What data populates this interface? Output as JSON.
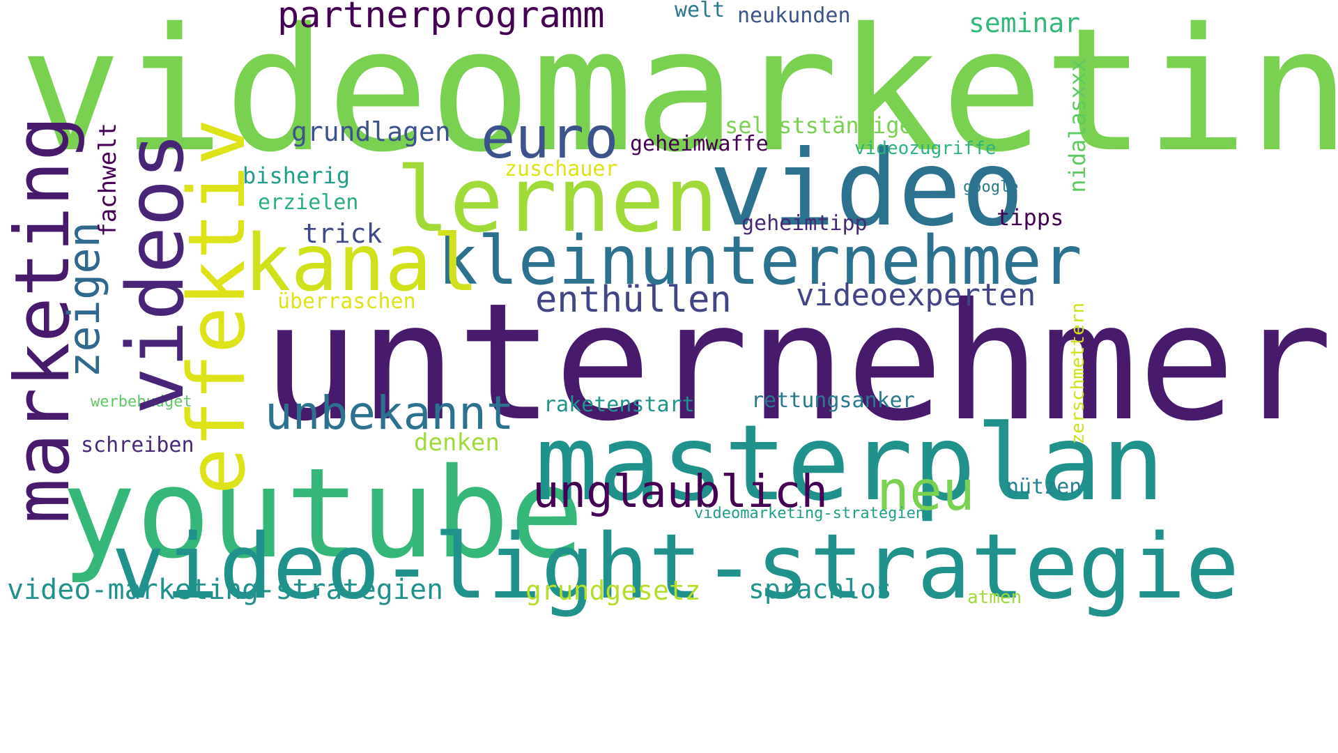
{
  "words": {
    "videomarketing": {
      "text": "videomarketing",
      "color": "#7ad151"
    },
    "unternehmer": {
      "text": "unternehmer",
      "color": "#481a6c"
    },
    "marketing": {
      "text": "marketing",
      "color": "#481a6c"
    },
    "videos": {
      "text": "videos",
      "color": "#482576"
    },
    "effektiv": {
      "text": "effektiv",
      "color": "#dde318"
    },
    "zeigen": {
      "text": "zeigen",
      "color": "#31688e"
    },
    "fachwelt": {
      "text": "fachwelt",
      "color": "#440154"
    },
    "youtube": {
      "text": "youtube",
      "color": "#35b779"
    },
    "masterplan": {
      "text": "masterplan",
      "color": "#21918c"
    },
    "video_light_strategie": {
      "text": "video-light-strategie",
      "color": "#21918c"
    },
    "video": {
      "text": "video",
      "color": "#2c728e"
    },
    "kleinunternehmer": {
      "text": "kleinunternehmer",
      "color": "#2c728e"
    },
    "lernen": {
      "text": "lernen",
      "color": "#a0da39"
    },
    "kanal": {
      "text": "kanal",
      "color": "#d0e11c"
    },
    "euro": {
      "text": "euro",
      "color": "#3b528b"
    },
    "partnerprogramm": {
      "text": "partnerprogramm",
      "color": "#440154"
    },
    "grundlagen": {
      "text": "grundlagen",
      "color": "#3b528b"
    },
    "unbekannt": {
      "text": "unbekannt",
      "color": "#2c728e"
    },
    "unglaublich": {
      "text": "unglaublich",
      "color": "#440154"
    },
    "neu": {
      "text": "neu",
      "color": "#7ad151"
    },
    "enthuellen": {
      "text": "enthüllen",
      "color": "#414487"
    },
    "videoexperten": {
      "text": "videoexperten",
      "color": "#414487"
    },
    "video_marketing_strategien": {
      "text": "video-marketing-strategien",
      "color": "#21918c"
    },
    "grundgesetz": {
      "text": "grundgesetz",
      "color": "#b5de2b"
    },
    "sprachlos": {
      "text": "sprachlos",
      "color": "#21918c"
    },
    "atmen": {
      "text": "atmen",
      "color": "#a0da39"
    },
    "welt": {
      "text": "welt",
      "color": "#2a788e"
    },
    "neukunden": {
      "text": "neukunden",
      "color": "#3b528b"
    },
    "seminar": {
      "text": "seminar",
      "color": "#35b779"
    },
    "selbststaendige": {
      "text": "selbstständige",
      "color": "#7ad151"
    },
    "geheimwaffe": {
      "text": "geheimwaffe",
      "color": "#440154"
    },
    "videozugriffe": {
      "text": "videozugriffe",
      "color": "#2db27d"
    },
    "nidalasxxx": {
      "text": "nidalasxxx",
      "color": "#5ec962"
    },
    "google": {
      "text": "google",
      "color": "#2a788e"
    },
    "tipps": {
      "text": "tipps",
      "color": "#440154"
    },
    "geheimtipp": {
      "text": "geheimtipp",
      "color": "#482878"
    },
    "zuschauer": {
      "text": "zuschauer",
      "color": "#dde318"
    },
    "bisherig": {
      "text": "bisherig",
      "color": "#1f9e89"
    },
    "erzielen": {
      "text": "erzielen",
      "color": "#28ae80"
    },
    "trick": {
      "text": "trick",
      "color": "#3e4989"
    },
    "ueberraschen": {
      "text": "überraschen",
      "color": "#dde318"
    },
    "zerschmettern": {
      "text": "zerschmettern",
      "color": "#d0e11c"
    },
    "werbebudget": {
      "text": "werbebudget",
      "color": "#5ec962"
    },
    "schreiben": {
      "text": "schreiben",
      "color": "#482878"
    },
    "raketenstart": {
      "text": "raketenstart",
      "color": "#21918c"
    },
    "rettungsanker": {
      "text": "rettungsanker",
      "color": "#2a788e"
    },
    "denken": {
      "text": "denken",
      "color": "#a0da39"
    },
    "nuetzen": {
      "text": "nützen",
      "color": "#26828e"
    },
    "videomarketing_strategien": {
      "text": "videomarketing-strategien",
      "color": "#1f9e89"
    }
  }
}
